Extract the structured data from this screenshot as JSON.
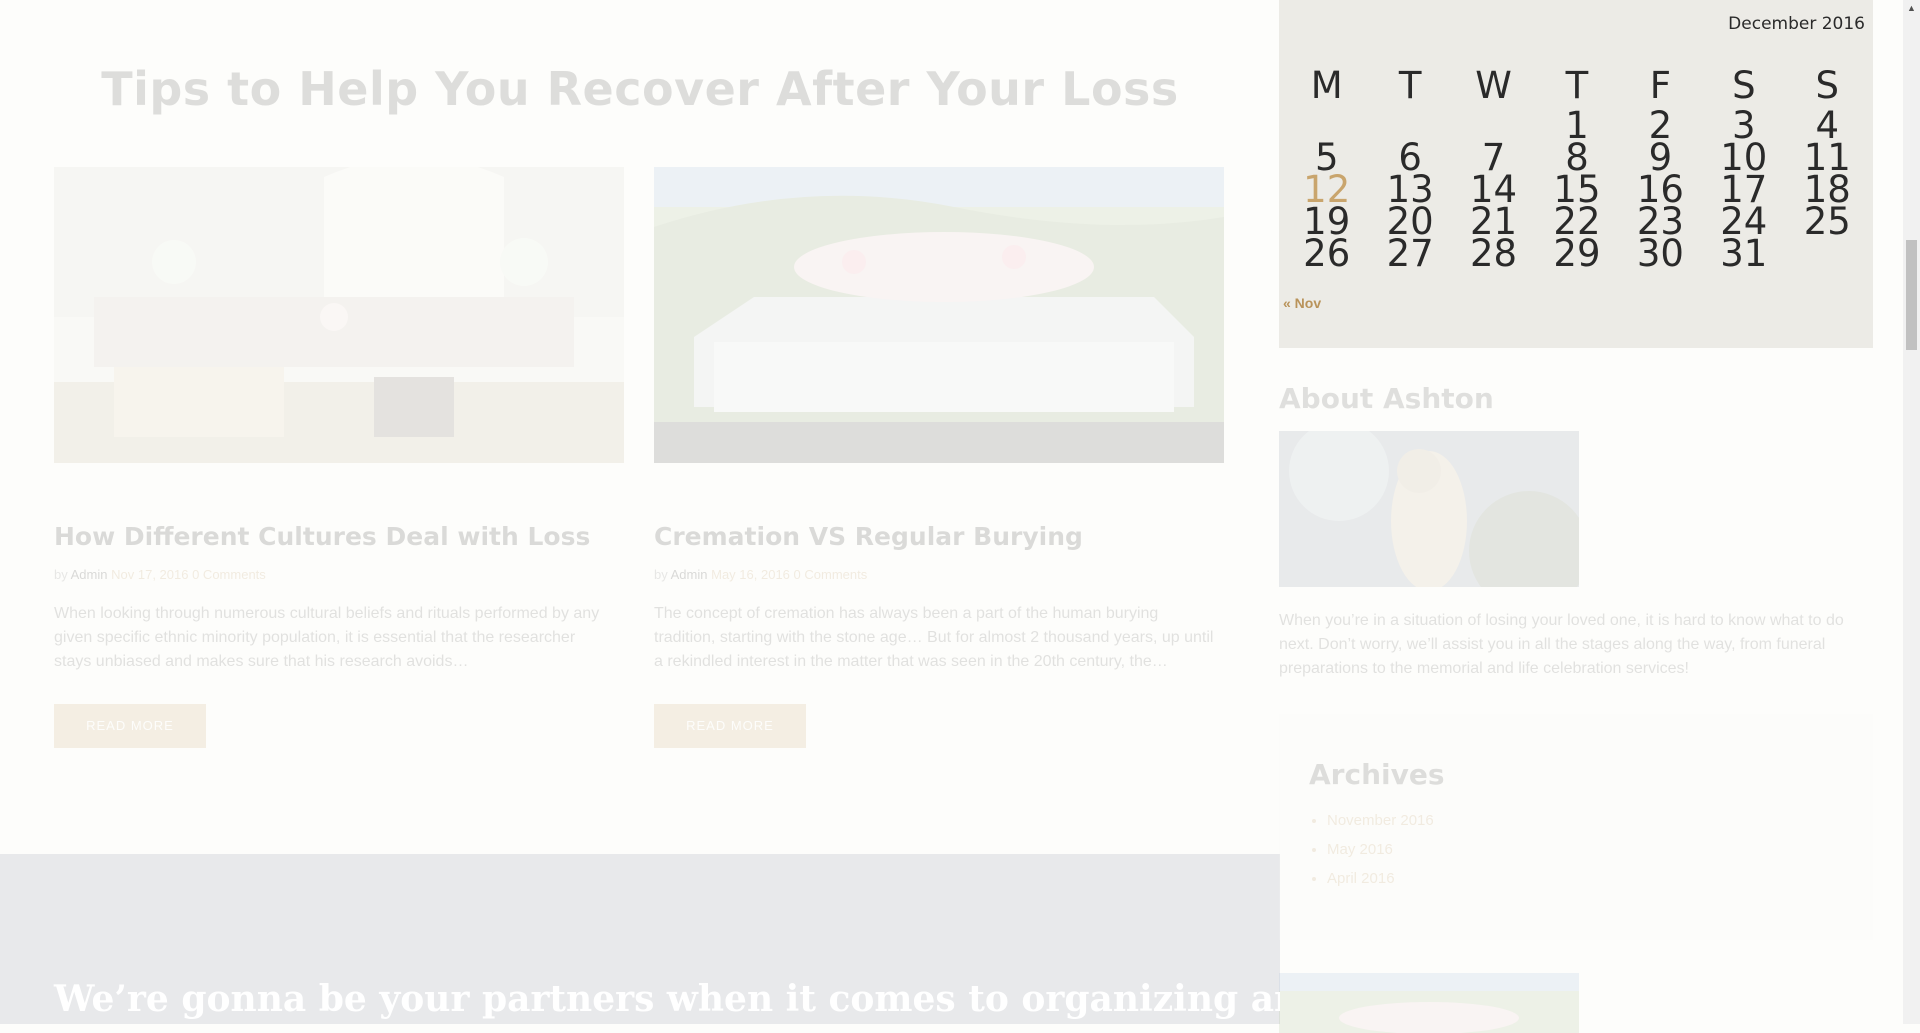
{
  "main": {
    "section_title": "Tips to Help You Recover After Your Loss",
    "posts": [
      {
        "title": "How Different Cultures Deal with Loss",
        "by": "by",
        "author": "Admin",
        "date": "Nov 17, 2016",
        "comments": "0 Comments",
        "excerpt": "When looking through numerous cultural beliefs and rituals performed by any given specific ethnic minority population, it is essential that the researcher stays unbiased and makes sure that his research avoids…",
        "button": "READ MORE"
      },
      {
        "title": "Cremation VS Regular Burying",
        "by": "by",
        "author": "Admin",
        "date": "May 16, 2016",
        "comments": "0 Comments",
        "excerpt": "The concept of cremation has always been a part of the human burying tradition, starting with the stone age… But for almost 2 thousand years, up until a rekindled interest in the matter that was seen in the 20th century, the…",
        "button": "READ MORE"
      }
    ],
    "banner_heading": "We’re gonna be your partners when it comes to organizing and"
  },
  "sidebar": {
    "calendar": {
      "caption": "December 2016",
      "weekdays": [
        "M",
        "T",
        "W",
        "T",
        "F",
        "S",
        "S"
      ],
      "weeks": [
        [
          "",
          "",
          "",
          "1",
          "2",
          "3",
          "4"
        ],
        [
          "5",
          "6",
          "7",
          "8",
          "9",
          "10",
          "11"
        ],
        [
          "12",
          "13",
          "14",
          "15",
          "16",
          "17",
          "18"
        ],
        [
          "19",
          "20",
          "21",
          "22",
          "23",
          "24",
          "25"
        ],
        [
          "26",
          "27",
          "28",
          "29",
          "30",
          "31",
          ""
        ]
      ],
      "today": "12",
      "prev_link": "« Nov"
    },
    "about": {
      "title": "About Ashton",
      "text": "When you’re in a situation of losing your loved one, it is hard to know what to do next. Don’t worry, we’ll assist you in all the stages along the way, from funeral preparations to the memorial and life celebration services!"
    },
    "archives": {
      "title": "Archives",
      "items": [
        "November 2016",
        "May 2016",
        "April 2016"
      ]
    }
  },
  "colors": {
    "accent": "#c9a56d",
    "calendar_bg": "#ecebe6",
    "banner_bg": "#6d7385"
  }
}
